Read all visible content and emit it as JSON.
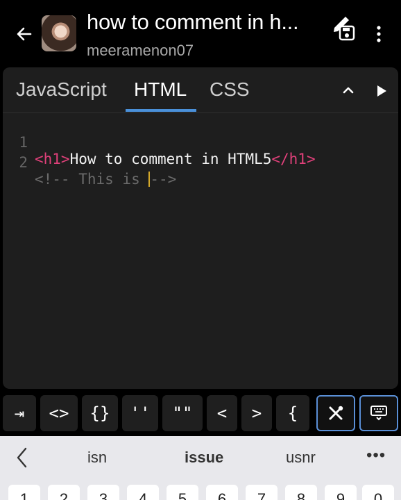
{
  "header": {
    "title": "how to comment in h...",
    "subtitle": "meeramenon07"
  },
  "tabs": [
    {
      "label": "JavaScript",
      "active": false
    },
    {
      "label": "HTML",
      "active": true
    },
    {
      "label": "CSS",
      "active": false
    }
  ],
  "code": {
    "line1": {
      "num": "1",
      "open_tag": "<h1>",
      "text": "How to comment in HTML5",
      "close_tag": "</h1>"
    },
    "line2": {
      "num": "2",
      "before_cursor": "<!-- This is ",
      "after_cursor": "-->"
    }
  },
  "accessory_keys": [
    "⇥",
    "<>",
    "{}",
    "''",
    "\"\"",
    "<",
    ">",
    "{"
  ],
  "suggestions": [
    "isn",
    "issue",
    "usnr"
  ],
  "number_row": [
    "1",
    "2",
    "3",
    "4",
    "5",
    "6",
    "7",
    "8",
    "9",
    "0"
  ],
  "colors": {
    "tag": "#e0407a",
    "accent": "#4a90d9",
    "cursor": "#d4a82a"
  }
}
